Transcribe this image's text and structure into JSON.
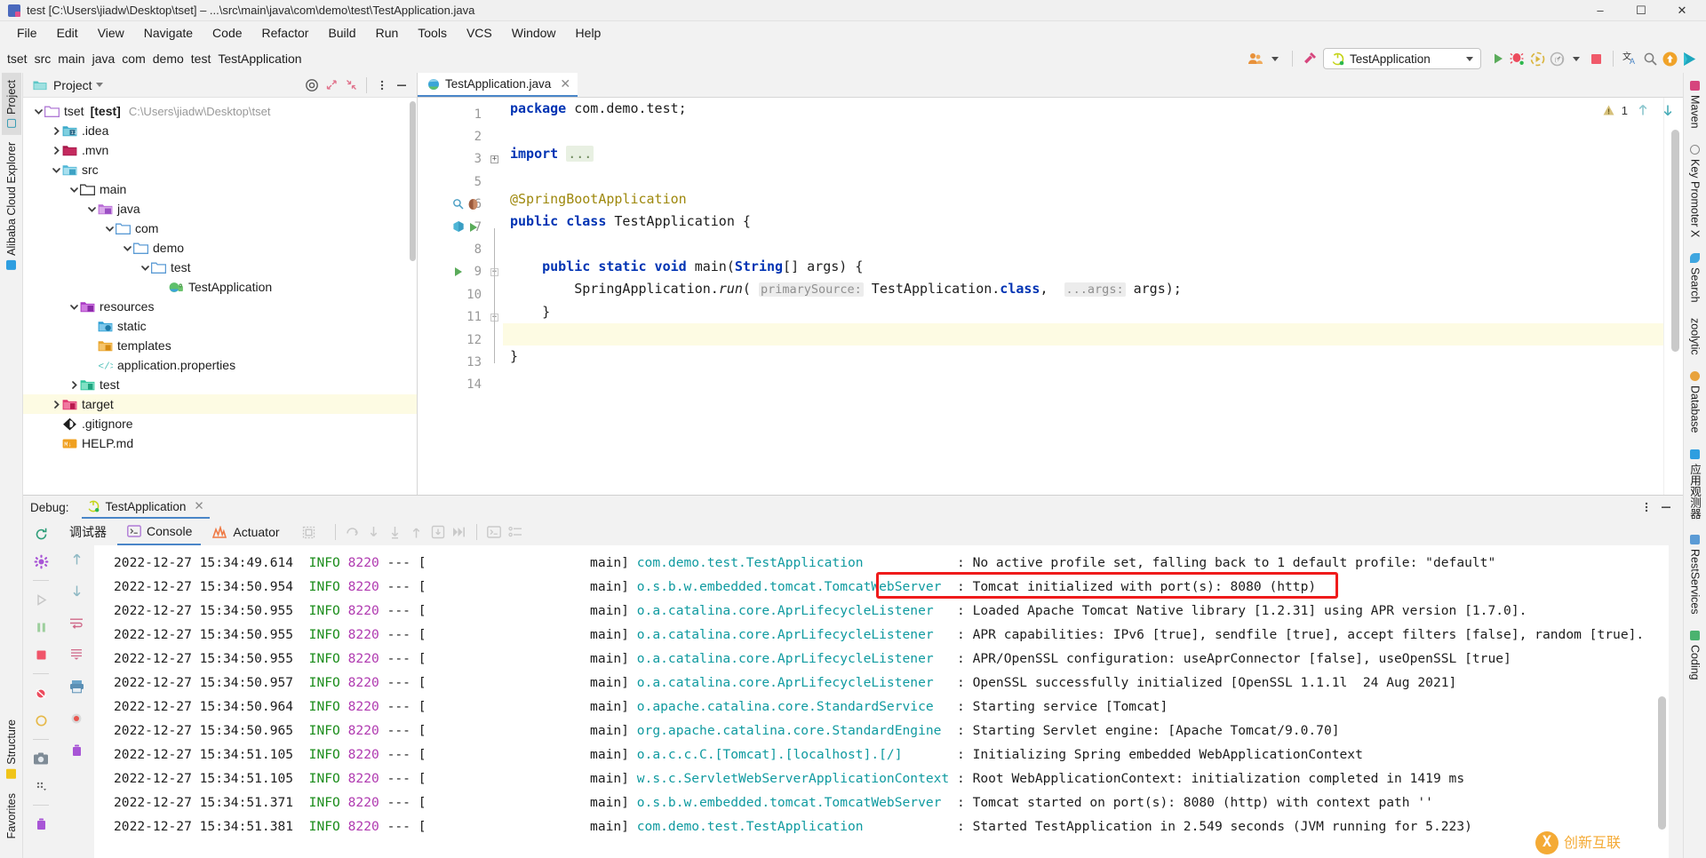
{
  "window": {
    "title": "test [C:\\Users\\jiadw\\Desktop\\tset] – ...\\src\\main\\java\\com\\demo\\test\\TestApplication.java",
    "minimize": "–",
    "maximize": "☐",
    "close": "✕"
  },
  "menubar": [
    {
      "label": "File"
    },
    {
      "label": "Edit"
    },
    {
      "label": "View"
    },
    {
      "label": "Navigate"
    },
    {
      "label": "Code"
    },
    {
      "label": "Refactor"
    },
    {
      "label": "Build"
    },
    {
      "label": "Run"
    },
    {
      "label": "Tools"
    },
    {
      "label": "VCS"
    },
    {
      "label": "Window"
    },
    {
      "label": "Help"
    }
  ],
  "breadcrumbs": [
    "tset",
    "src",
    "main",
    "java",
    "com",
    "demo",
    "test",
    "TestApplication"
  ],
  "toolbar": {
    "run_config": "TestApplication",
    "icons": [
      "people-icon",
      "chevron-down-icon",
      "build-hammer-icon",
      "run-icon",
      "debug-icon",
      "run-coverage-icon",
      "profiler-icon",
      "stop-icon",
      "translate-icon",
      "search-icon",
      "update-icon",
      "send-icon"
    ]
  },
  "left_tool_tabs": [
    {
      "label": "Project",
      "active": true
    },
    {
      "label": "Alibaba Cloud Explorer",
      "active": false
    },
    {
      "label": "Structure",
      "active": false
    },
    {
      "label": "Favorites",
      "active": false
    }
  ],
  "right_tool_tabs": [
    {
      "label": "Maven"
    },
    {
      "label": "Key Promoter X"
    },
    {
      "label": "Search"
    },
    {
      "label": "zoolytic"
    },
    {
      "label": "Database"
    },
    {
      "label": "应用观测器"
    },
    {
      "label": "RestServices"
    },
    {
      "label": "Coding"
    }
  ],
  "project_panel": {
    "title": "Project",
    "header_icons": [
      "target-scope-icon",
      "expand-all-icon",
      "collapse-all-icon",
      "more-options-icon",
      "hide-icon"
    ],
    "tree": [
      {
        "indent": 0,
        "arrow": "down",
        "icon": "module-folder-icon",
        "label": "tset",
        "bold": "[test]",
        "path": "C:\\Users\\jiadw\\Desktop\\tset",
        "selected": false
      },
      {
        "indent": 1,
        "arrow": "right",
        "icon": "idea-folder-icon",
        "label": ".idea",
        "selected": false
      },
      {
        "indent": 1,
        "arrow": "right",
        "icon": "mvn-folder-icon",
        "label": ".mvn",
        "selected": false
      },
      {
        "indent": 1,
        "arrow": "down",
        "icon": "src-folder-icon",
        "label": "src",
        "selected": false
      },
      {
        "indent": 2,
        "arrow": "down",
        "icon": "plain-folder-icon",
        "label": "main",
        "selected": false
      },
      {
        "indent": 3,
        "arrow": "down",
        "icon": "java-source-icon",
        "label": "java",
        "selected": false
      },
      {
        "indent": 4,
        "arrow": "down",
        "icon": "package-folder-icon",
        "label": "com",
        "selected": false
      },
      {
        "indent": 5,
        "arrow": "down",
        "icon": "package-folder-icon",
        "label": "demo",
        "selected": false
      },
      {
        "indent": 6,
        "arrow": "down",
        "icon": "package-folder-icon",
        "label": "test",
        "selected": false
      },
      {
        "indent": 7,
        "arrow": "none",
        "icon": "spring-class-icon",
        "label": "TestApplication",
        "selected": false
      },
      {
        "indent": 2,
        "arrow": "down",
        "icon": "resources-folder-icon",
        "label": "resources",
        "selected": false
      },
      {
        "indent": 3,
        "arrow": "none",
        "icon": "static-folder-icon",
        "label": "static",
        "selected": false
      },
      {
        "indent": 3,
        "arrow": "none",
        "icon": "templates-folder-icon",
        "label": "templates",
        "selected": false
      },
      {
        "indent": 3,
        "arrow": "none",
        "icon": "properties-file-icon",
        "label": "application.properties",
        "selected": false
      },
      {
        "indent": 2,
        "arrow": "right",
        "icon": "test-folder-icon",
        "label": "test",
        "selected": false
      },
      {
        "indent": 1,
        "arrow": "right",
        "icon": "target-folder-icon",
        "label": "target",
        "selected": true
      },
      {
        "indent": 1,
        "arrow": "none",
        "icon": "git-icon",
        "label": ".gitignore",
        "selected": false
      },
      {
        "indent": 1,
        "arrow": "none",
        "icon": "markdown-icon",
        "label": "HELP.md",
        "selected": false
      }
    ]
  },
  "editor": {
    "tab": {
      "label": "TestApplication.java",
      "close": "✕"
    },
    "warning_count": "1",
    "lines": [
      {
        "num": "1",
        "indent": 0,
        "tokens": [
          {
            "t": "kw",
            "v": "package "
          },
          {
            "t": "id",
            "v": "com.demo.test;"
          }
        ]
      },
      {
        "num": "2",
        "indent": 0,
        "tokens": []
      },
      {
        "num": "3",
        "indent": 0,
        "fold": "collapsed",
        "tokens": [
          {
            "t": "kw",
            "v": "import "
          },
          {
            "t": "fold",
            "v": "..."
          }
        ]
      },
      {
        "num": "5",
        "indent": 0,
        "tokens": []
      },
      {
        "num": "6",
        "indent": 0,
        "gutter": [
          "inspect-search-icon",
          "bean-icon"
        ],
        "tokens": [
          {
            "t": "ann",
            "v": "@SpringBootApplication"
          }
        ]
      },
      {
        "num": "7",
        "indent": 0,
        "gutter": [
          "spring-bean-icon",
          "run-gutter-icon"
        ],
        "tokens": [
          {
            "t": "kw",
            "v": "public class "
          },
          {
            "t": "id",
            "v": "TestApplication "
          },
          {
            "t": "id",
            "v": "{"
          }
        ]
      },
      {
        "num": "8",
        "indent": 0,
        "tokens": []
      },
      {
        "num": "9",
        "indent": 1,
        "gutter": [
          "run-gutter-icon"
        ],
        "fold": "open",
        "tokens": [
          {
            "t": "kw",
            "v": "public static void "
          },
          {
            "t": "mth",
            "v": "main"
          },
          {
            "t": "id",
            "v": "("
          },
          {
            "t": "kw",
            "v": "String"
          },
          {
            "t": "id",
            "v": "[] args) {"
          }
        ]
      },
      {
        "num": "10",
        "indent": 2,
        "tokens": [
          {
            "t": "id",
            "v": "SpringApplication."
          },
          {
            "t": "mthi",
            "v": "run"
          },
          {
            "t": "id",
            "v": "( "
          },
          {
            "t": "hint",
            "v": "primarySource:"
          },
          {
            "t": "id",
            "v": " TestApplication."
          },
          {
            "t": "kw",
            "v": "class"
          },
          {
            "t": "id",
            "v": ",  "
          },
          {
            "t": "hint",
            "v": "...args:"
          },
          {
            "t": "id",
            "v": " args);"
          }
        ]
      },
      {
        "num": "11",
        "indent": 1,
        "fold": "end",
        "tokens": [
          {
            "t": "id",
            "v": "}"
          }
        ]
      },
      {
        "num": "12",
        "indent": 0,
        "highlight": true,
        "tokens": []
      },
      {
        "num": "13",
        "indent": 0,
        "tokens": [
          {
            "t": "id",
            "v": "}"
          }
        ]
      },
      {
        "num": "14",
        "indent": 0,
        "tokens": []
      }
    ]
  },
  "debug": {
    "label": "Debug:",
    "session_tab": "TestApplication",
    "session_close": "✕",
    "header_icons": [
      "more-options-icon",
      "hide-icon"
    ],
    "left_icons": [
      "rerun-icon",
      "settings-icon",
      "resume-icon",
      "pause-icon",
      "stop-icon",
      "mute-breakpoints-icon",
      "view-breakpoints-icon",
      "screenshot-icon",
      "more-icon",
      "trash-icon"
    ],
    "tabs": [
      {
        "label": "调试器",
        "icon": "debugger-icon",
        "active": false
      },
      {
        "label": "Console",
        "icon": "console-icon",
        "active": true
      },
      {
        "label": "Actuator",
        "icon": "actuator-icon",
        "active": false
      }
    ],
    "tab_actions": [
      "layout-icon",
      "step-over-icon",
      "step-into-icon",
      "force-step-into-icon",
      "step-out-icon",
      "drop-frame-icon",
      "run-to-cursor-icon",
      "evaluate-icon",
      "settings-list-icon"
    ],
    "console_side_icons": [
      "scroll-up-icon",
      "scroll-down-icon",
      "soft-wrap-icon",
      "scroll-to-end-icon",
      "print-icon",
      "record-icon",
      "clear-icon"
    ],
    "console_lines": [
      {
        "time": "2022-12-27 15:34:49.614",
        "level": "INFO",
        "pid": "8220",
        "thread": "main",
        "logger": "com.demo.test.TestApplication",
        "msg": "No active profile set, falling back to 1 default profile: \"default\"",
        "highlight": false
      },
      {
        "time": "2022-12-27 15:34:50.954",
        "level": "INFO",
        "pid": "8220",
        "thread": "main",
        "logger": "o.s.b.w.embedded.tomcat.TomcatWebServer",
        "msg": "Tomcat initialized with port(s): 8080 (http)",
        "highlight": true
      },
      {
        "time": "2022-12-27 15:34:50.955",
        "level": "INFO",
        "pid": "8220",
        "thread": "main",
        "logger": "o.a.catalina.core.AprLifecycleListener",
        "msg": "Loaded Apache Tomcat Native library [1.2.31] using APR version [1.7.0].",
        "highlight": false
      },
      {
        "time": "2022-12-27 15:34:50.955",
        "level": "INFO",
        "pid": "8220",
        "thread": "main",
        "logger": "o.a.catalina.core.AprLifecycleListener",
        "msg": "APR capabilities: IPv6 [true], sendfile [true], accept filters [false], random [true].",
        "highlight": false
      },
      {
        "time": "2022-12-27 15:34:50.955",
        "level": "INFO",
        "pid": "8220",
        "thread": "main",
        "logger": "o.a.catalina.core.AprLifecycleListener",
        "msg": "APR/OpenSSL configuration: useAprConnector [false], useOpenSSL [true]",
        "highlight": false
      },
      {
        "time": "2022-12-27 15:34:50.957",
        "level": "INFO",
        "pid": "8220",
        "thread": "main",
        "logger": "o.a.catalina.core.AprLifecycleListener",
        "msg": "OpenSSL successfully initialized [OpenSSL 1.1.1l  24 Aug 2021]",
        "highlight": false
      },
      {
        "time": "2022-12-27 15:34:50.964",
        "level": "INFO",
        "pid": "8220",
        "thread": "main",
        "logger": "o.apache.catalina.core.StandardService",
        "msg": "Starting service [Tomcat]",
        "highlight": false
      },
      {
        "time": "2022-12-27 15:34:50.965",
        "level": "INFO",
        "pid": "8220",
        "thread": "main",
        "logger": "org.apache.catalina.core.StandardEngine",
        "msg": "Starting Servlet engine: [Apache Tomcat/9.0.70]",
        "highlight": false
      },
      {
        "time": "2022-12-27 15:34:51.105",
        "level": "INFO",
        "pid": "8220",
        "thread": "main",
        "logger": "o.a.c.c.C.[Tomcat].[localhost].[/]",
        "msg": "Initializing Spring embedded WebApplicationContext",
        "highlight": false
      },
      {
        "time": "2022-12-27 15:34:51.105",
        "level": "INFO",
        "pid": "8220",
        "thread": "main",
        "logger": "w.s.c.ServletWebServerApplicationContext",
        "msg": "Root WebApplicationContext: initialization completed in 1419 ms",
        "highlight": false
      },
      {
        "time": "2022-12-27 15:34:51.371",
        "level": "INFO",
        "pid": "8220",
        "thread": "main",
        "logger": "o.s.b.w.embedded.tomcat.TomcatWebServer",
        "msg": "Tomcat started on port(s): 8080 (http) with context path ''",
        "highlight": false
      },
      {
        "time": "2022-12-27 15:34:51.381",
        "level": "INFO",
        "pid": "8220",
        "thread": "main",
        "logger": "com.demo.test.TestApplication",
        "msg": "Started TestApplication in 2.549 seconds (JVM running for 5.223)",
        "highlight": false
      }
    ]
  },
  "watermark": {
    "mark": "X",
    "text": "创新互联"
  },
  "colors": {
    "accent_blue": "#4a86c8",
    "keyword": "#0033b3",
    "annotation": "#9e880d",
    "logger_teal": "#0f9aa0",
    "info_green": "#1a8c1a",
    "pid_purple": "#b03ab0",
    "highlight_red": "#ef1b1b",
    "selection_yellow": "#fdfbe3"
  }
}
